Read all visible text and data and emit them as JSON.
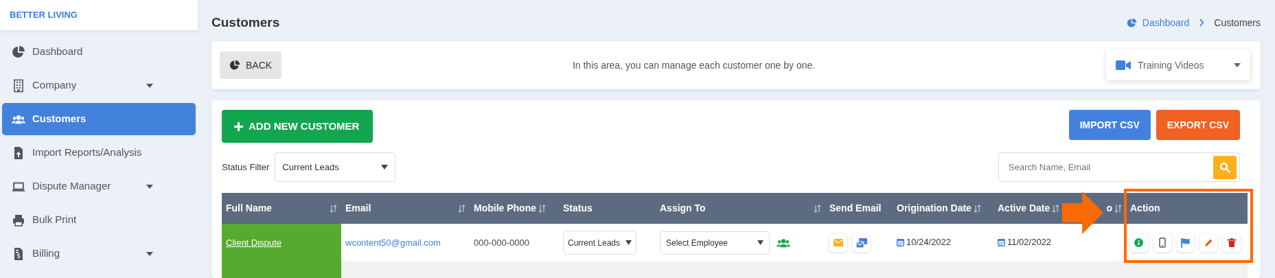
{
  "brand": "BETTER LIVING",
  "sidebar": {
    "items": [
      {
        "label": "Dashboard",
        "has_submenu": false,
        "selected": false
      },
      {
        "label": "Company",
        "has_submenu": true,
        "selected": false
      },
      {
        "label": "Customers",
        "has_submenu": false,
        "selected": true
      },
      {
        "label": "Import Reports/Analysis",
        "has_submenu": false,
        "selected": false
      },
      {
        "label": "Dispute Manager",
        "has_submenu": true,
        "selected": false
      },
      {
        "label": "Bulk Print",
        "has_submenu": false,
        "selected": false
      },
      {
        "label": "Billing",
        "has_submenu": true,
        "selected": false
      }
    ]
  },
  "page_title": "Customers",
  "breadcrumb": [
    {
      "label": "Dashboard",
      "link": true
    },
    {
      "label": "Customers",
      "link": false
    }
  ],
  "info_bar": {
    "back_button": "BACK",
    "message": "In this area, you can manage each customer one by one.",
    "training_videos": "Training Videos"
  },
  "toolbar": {
    "add_button": "ADD NEW CUSTOMER",
    "import_button": "IMPORT CSV",
    "export_button": "EXPORT CSV"
  },
  "status_filter": {
    "label": "Status Filter",
    "value": "Current Leads"
  },
  "search": {
    "placeholder": "Search Name, Email"
  },
  "table": {
    "columns": [
      {
        "label": "Full Name",
        "sortable": true
      },
      {
        "label": "Email",
        "sortable": true
      },
      {
        "label": "Mobile Phone",
        "sortable": true
      },
      {
        "label": "Status",
        "sortable": false
      },
      {
        "label": "Assign To",
        "sortable": true
      },
      {
        "label": "Send Email",
        "sortable": false
      },
      {
        "label": "Origination Date",
        "sortable": true
      },
      {
        "label": "Active Date",
        "sortable": true
      },
      {
        "label": "o",
        "sortable": true
      },
      {
        "label": "Action",
        "sortable": false
      }
    ],
    "rows": [
      {
        "full_name": "Client Dispute",
        "email": "wcontent50@gmail.com",
        "mobile_phone": "000-000-0000",
        "status": "Current Leads",
        "assign_to": "Select Employee",
        "origination_date": "10/24/2022",
        "active_date": "11/02/2022"
      }
    ]
  }
}
